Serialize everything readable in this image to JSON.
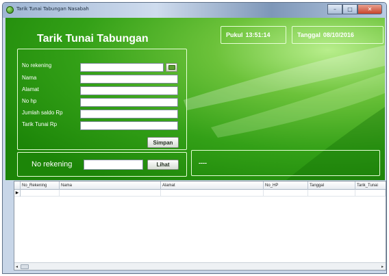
{
  "window": {
    "title": "Tarik Tunai Tabungan Nasabah",
    "controls": {
      "minimize": "–",
      "maximize": "□",
      "close": "✕"
    }
  },
  "header": {
    "app_title": "Tarik Tunai Tabungan"
  },
  "clock": {
    "time_label": "Pukul",
    "time_value": "13:51:14",
    "date_label": "Tanggal",
    "date_value": "08/10/2016"
  },
  "form": {
    "fields": [
      {
        "label": "No rekening",
        "value": ""
      },
      {
        "label": "Nama",
        "value": ""
      },
      {
        "label": "Alamat",
        "value": ""
      },
      {
        "label": "No hp",
        "value": ""
      },
      {
        "label": "Jumlah saldo  Rp",
        "value": ""
      },
      {
        "label": "Tarik Tunai    Rp",
        "value": ""
      }
    ],
    "save_label": "Simpan",
    "browse_icon": "folder-icon"
  },
  "search": {
    "label": "No rekening",
    "value": "",
    "button_label": "Lihat"
  },
  "result": {
    "text": "----"
  },
  "grid": {
    "columns": [
      "No_Rekening",
      "Nama",
      "Alamat",
      "No_HP",
      "Tanggal",
      "Tarik_Tunai"
    ],
    "row_marker": "▶",
    "scroll_left": "◂",
    "scroll_right": "▸"
  },
  "colors": {
    "primary_green": "#33a017",
    "light_green": "#b8ee8c",
    "text_white": "#ffffff"
  }
}
